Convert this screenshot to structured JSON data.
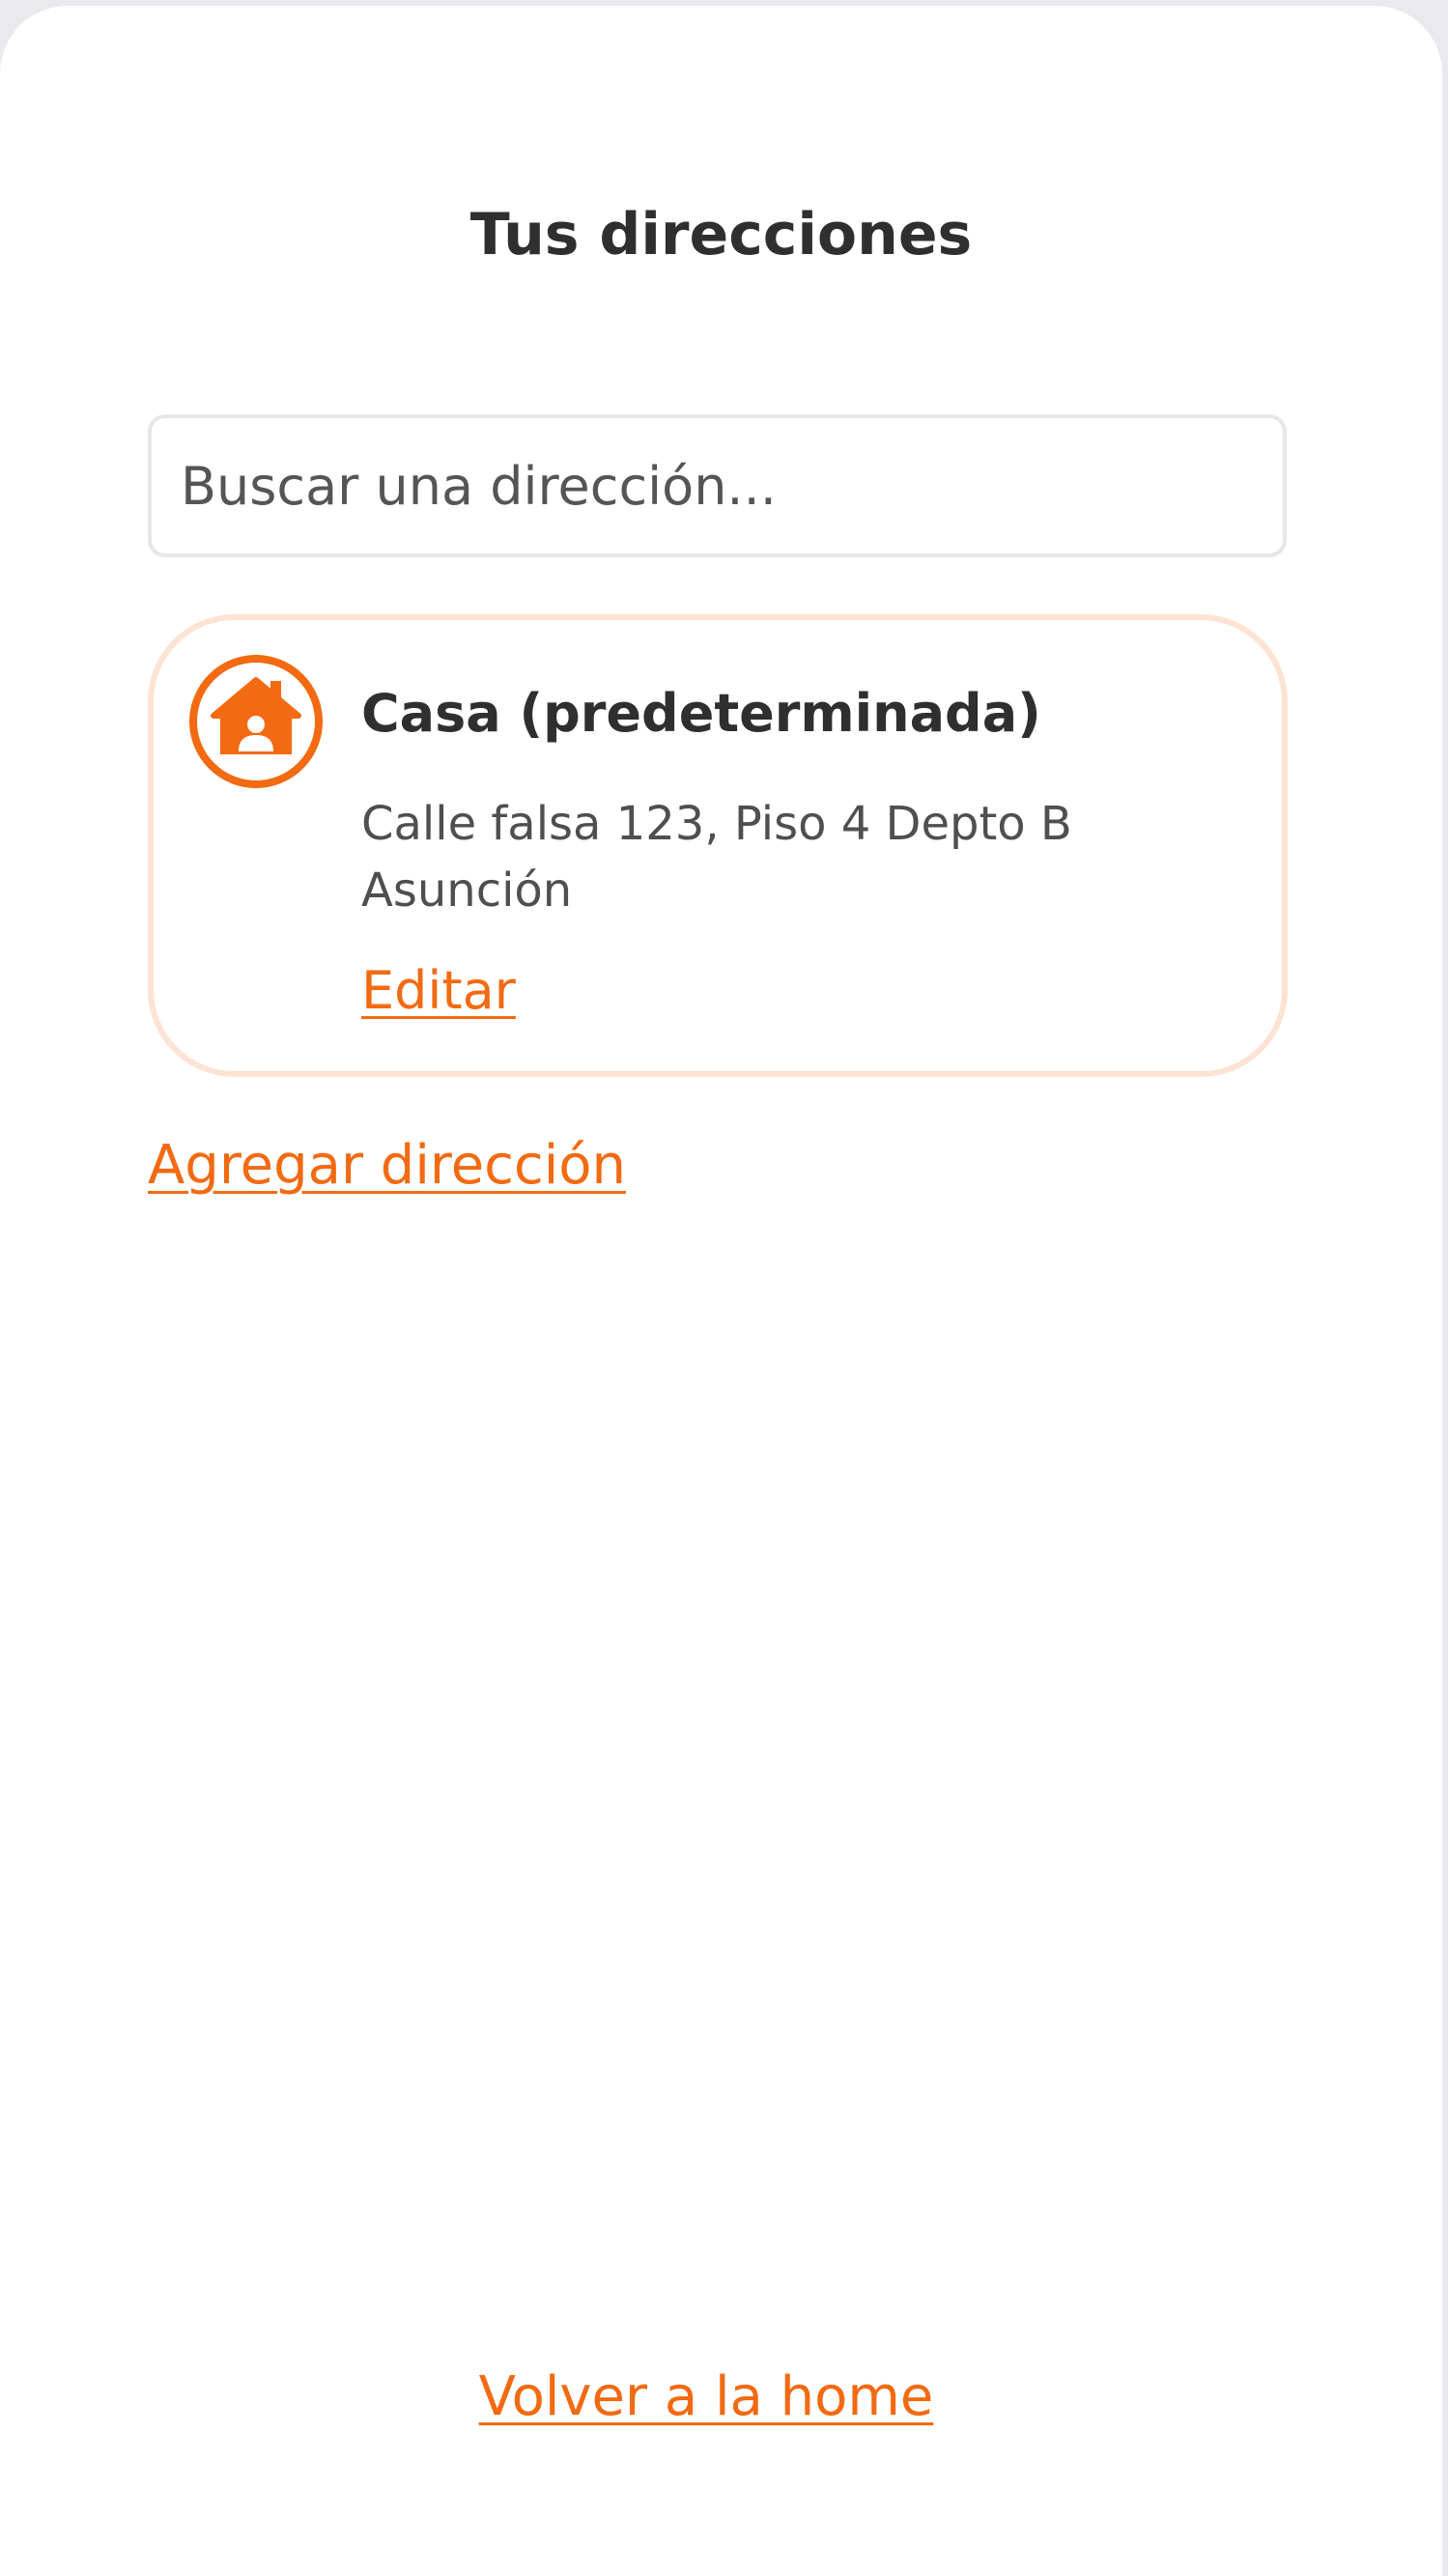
{
  "page": {
    "title": "Tus direcciones"
  },
  "search": {
    "placeholder": "Buscar una dirección...",
    "value": ""
  },
  "addresses": [
    {
      "name": "Casa (predeterminada)",
      "line1": "Calle falsa 123, Piso 4 Depto B",
      "line2": "Asunción",
      "edit_label": "Editar",
      "icon": "home-icon"
    }
  ],
  "actions": {
    "add_label": "Agregar dirección",
    "back_label": "Volver a la home"
  },
  "colors": {
    "accent": "#f26a11",
    "card_border": "#fde3d3",
    "text_dark": "#2f2f2f",
    "text_muted": "#4f4f4f"
  }
}
